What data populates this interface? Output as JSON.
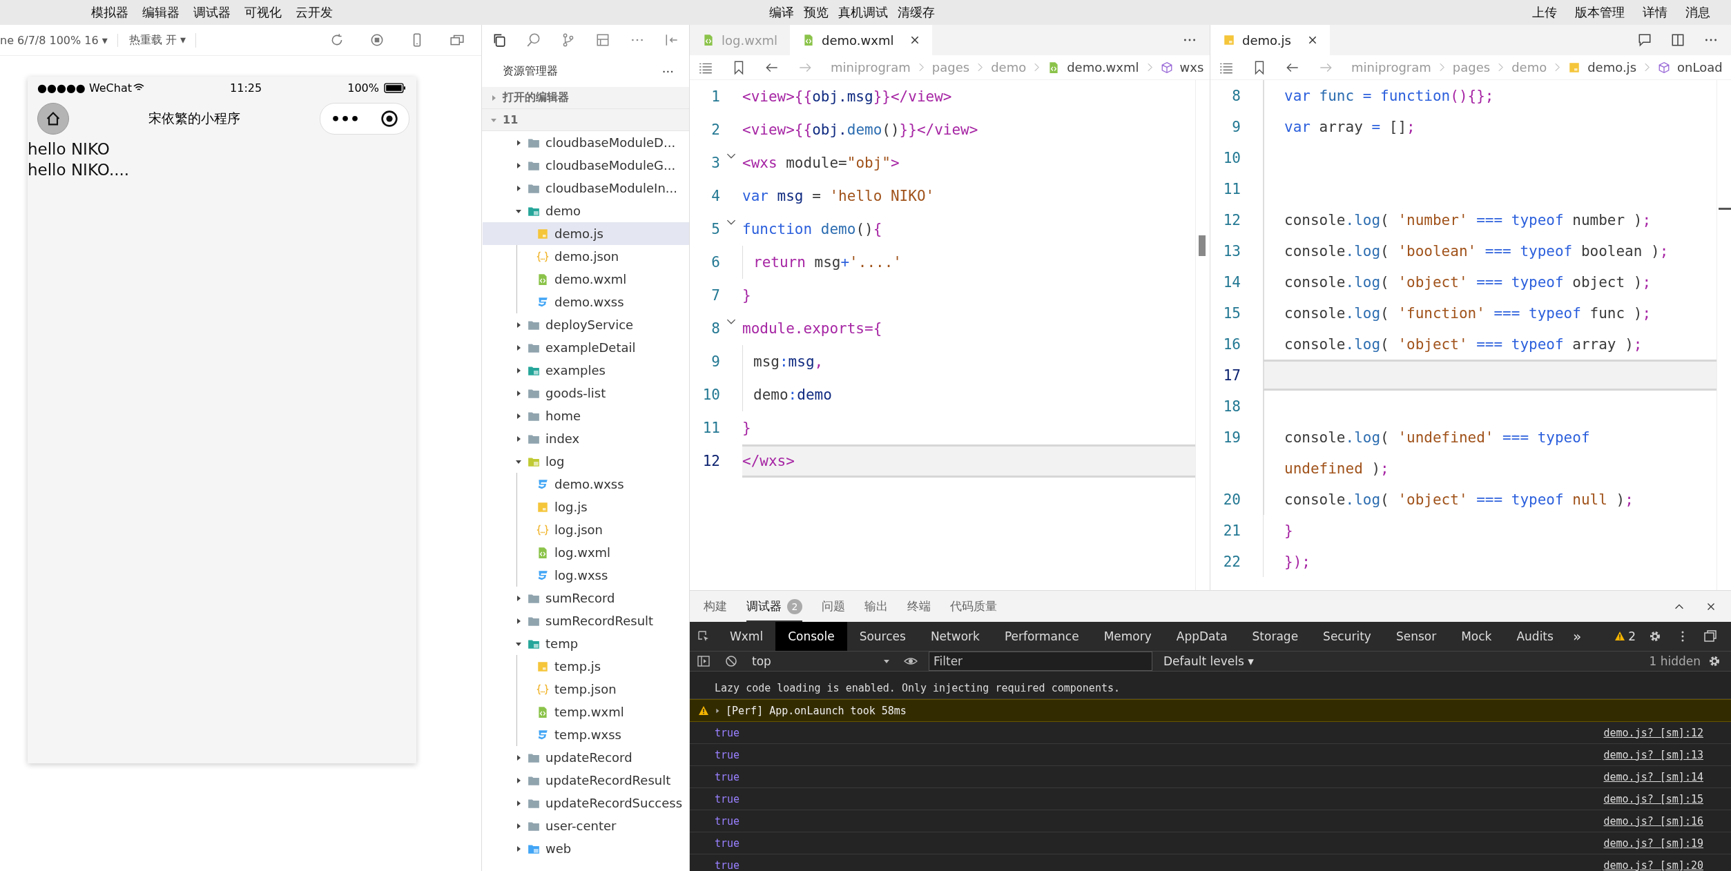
{
  "menu_bar": {
    "left": [
      "模拟器",
      "编辑器",
      "调试器",
      "可视化",
      "云开发"
    ],
    "center": [
      "编译",
      "预览",
      "真机调试",
      "清缓存"
    ],
    "right": [
      "上传",
      "版本管理",
      "详情",
      "消息"
    ]
  },
  "simulator": {
    "device_select": "ne 6/7/8 100% 16 ▾",
    "hot_reload": "热重载 开 ▾",
    "phone": {
      "carrier": "●●●●● WeChat",
      "time": "11:25",
      "battery": "100%",
      "title": "宋依繁的小程序",
      "capsule_more": "•••",
      "content": [
        "hello NIKO",
        "hello NIKO...."
      ]
    }
  },
  "explorer": {
    "title": "资源管理器",
    "more": "···",
    "sections": [
      {
        "label": "打开的编辑器",
        "expanded": false
      },
      {
        "label": "11",
        "expanded": true
      }
    ],
    "tree": [
      {
        "label": "cloudbaseModuleD...",
        "kind": "folder",
        "expanded": false,
        "selected": false
      },
      {
        "label": "cloudbaseModuleG...",
        "kind": "folder",
        "expanded": false,
        "selected": false
      },
      {
        "label": "cloudbaseModuleIn...",
        "kind": "folder",
        "expanded": false,
        "selected": false
      },
      {
        "label": "demo",
        "kind": "folder-image",
        "expanded": true,
        "selected": false,
        "children": [
          {
            "label": "demo.js",
            "kind": "js",
            "selected": true
          },
          {
            "label": "demo.json",
            "kind": "json",
            "selected": false
          },
          {
            "label": "demo.wxml",
            "kind": "wxml",
            "selected": false
          },
          {
            "label": "demo.wxss",
            "kind": "wxss",
            "selected": false
          }
        ]
      },
      {
        "label": "deployService",
        "kind": "folder",
        "expanded": false,
        "selected": false
      },
      {
        "label": "exampleDetail",
        "kind": "folder",
        "expanded": false,
        "selected": false
      },
      {
        "label": "examples",
        "kind": "folder-image",
        "expanded": false,
        "selected": false
      },
      {
        "label": "goods-list",
        "kind": "folder",
        "expanded": false,
        "selected": false
      },
      {
        "label": "home",
        "kind": "folder",
        "expanded": false,
        "selected": false
      },
      {
        "label": "index",
        "kind": "folder",
        "expanded": false,
        "selected": false
      },
      {
        "label": "log",
        "kind": "folder-log",
        "expanded": true,
        "selected": false,
        "children": [
          {
            "label": "demo.wxss",
            "kind": "wxss",
            "selected": false
          },
          {
            "label": "log.js",
            "kind": "js",
            "selected": false
          },
          {
            "label": "log.json",
            "kind": "json",
            "selected": false
          },
          {
            "label": "log.wxml",
            "kind": "wxml",
            "selected": false
          },
          {
            "label": "log.wxss",
            "kind": "wxss",
            "selected": false
          }
        ]
      },
      {
        "label": "sumRecord",
        "kind": "folder",
        "expanded": false,
        "selected": false
      },
      {
        "label": "sumRecordResult",
        "kind": "folder",
        "expanded": false,
        "selected": false
      },
      {
        "label": "temp",
        "kind": "folder-temp",
        "expanded": true,
        "selected": false,
        "children": [
          {
            "label": "temp.js",
            "kind": "js",
            "selected": false
          },
          {
            "label": "temp.json",
            "kind": "json",
            "selected": false
          },
          {
            "label": "temp.wxml",
            "kind": "wxml",
            "selected": false
          },
          {
            "label": "temp.wxss",
            "kind": "wxss",
            "selected": false
          }
        ]
      },
      {
        "label": "updateRecord",
        "kind": "folder",
        "expanded": false,
        "selected": false
      },
      {
        "label": "updateRecordResult",
        "kind": "folder",
        "expanded": false,
        "selected": false
      },
      {
        "label": "updateRecordSuccess",
        "kind": "folder",
        "expanded": false,
        "selected": false
      },
      {
        "label": "user-center",
        "kind": "folder",
        "expanded": false,
        "selected": false
      },
      {
        "label": "web",
        "kind": "folder-web",
        "expanded": false,
        "selected": false
      }
    ]
  },
  "editors": [
    {
      "tabs": [
        {
          "label": "log.wxml",
          "kind": "wxml",
          "selected": false
        },
        {
          "label": "demo.wxml",
          "kind": "wxml",
          "selected": true
        }
      ],
      "breadcrumb": [
        {
          "label": "miniprogram",
          "kind": "folder"
        },
        {
          "label": "pages",
          "kind": "folder"
        },
        {
          "label": "demo",
          "kind": "folder"
        },
        {
          "label": "demo.wxml",
          "kind": "wxml"
        },
        {
          "label": "wxs",
          "kind": "cube"
        }
      ],
      "lines": [
        {
          "number": "1",
          "current": false,
          "fold": false,
          "guide": false,
          "tokens": [
            {
              "kind": "tag",
              "text": "<view>"
            },
            {
              "kind": "punct",
              "text": "{{"
            },
            {
              "kind": "ident",
              "text": "obj.msg"
            },
            {
              "kind": "punct",
              "text": "}}"
            },
            {
              "kind": "tag",
              "text": "</view>"
            }
          ]
        },
        {
          "number": "2",
          "current": false,
          "fold": false,
          "guide": false,
          "tokens": [
            {
              "kind": "tag",
              "text": "<view>"
            },
            {
              "kind": "punct",
              "text": "{{"
            },
            {
              "kind": "ident",
              "text": "obj."
            },
            {
              "kind": "method",
              "text": "demo"
            },
            {
              "kind": "plain",
              "text": "()"
            },
            {
              "kind": "punct",
              "text": "}}"
            },
            {
              "kind": "tag",
              "text": "</view>"
            }
          ]
        },
        {
          "number": "3",
          "current": false,
          "fold": true,
          "guide": false,
          "tokens": [
            {
              "kind": "tag",
              "text": "<wxs"
            },
            {
              "kind": "plain",
              "text": " module="
            },
            {
              "kind": "string",
              "text": "\"obj\""
            },
            {
              "kind": "tag",
              "text": ">"
            }
          ]
        },
        {
          "number": "4",
          "current": false,
          "fold": false,
          "guide": false,
          "tokens": [
            {
              "kind": "keyword",
              "text": "var"
            },
            {
              "kind": "ident",
              "text": " msg"
            },
            {
              "kind": "plain",
              "text": " = "
            },
            {
              "kind": "string",
              "text": "'hello NIKO'"
            }
          ]
        },
        {
          "number": "5",
          "current": false,
          "fold": true,
          "guide": false,
          "tokens": [
            {
              "kind": "keyword",
              "text": "function"
            },
            {
              "kind": "method",
              "text": " demo"
            },
            {
              "kind": "plain",
              "text": "()"
            },
            {
              "kind": "punct",
              "text": "{"
            }
          ]
        },
        {
          "number": "6",
          "current": false,
          "fold": false,
          "guide": true,
          "tokens": [
            {
              "kind": "tag",
              "text": "return"
            },
            {
              "kind": "plain",
              "text": " msg"
            },
            {
              "kind": "keyword",
              "text": "+"
            },
            {
              "kind": "string",
              "text": "'....'"
            }
          ]
        },
        {
          "number": "7",
          "current": false,
          "fold": false,
          "guide": false,
          "tokens": [
            {
              "kind": "punct",
              "text": "}"
            }
          ]
        },
        {
          "number": "8",
          "current": false,
          "fold": true,
          "guide": false,
          "tokens": [
            {
              "kind": "tag",
              "text": "module.exports="
            },
            {
              "kind": "punct",
              "text": "{"
            }
          ]
        },
        {
          "number": "9",
          "current": false,
          "fold": false,
          "guide": true,
          "tokens": [
            {
              "kind": "plain",
              "text": "msg"
            },
            {
              "kind": "keyword",
              "text": ":"
            },
            {
              "kind": "ident",
              "text": "msg"
            },
            {
              "kind": "punct",
              "text": ","
            }
          ]
        },
        {
          "number": "10",
          "current": false,
          "fold": false,
          "guide": true,
          "tokens": [
            {
              "kind": "plain",
              "text": "demo"
            },
            {
              "kind": "keyword",
              "text": ":"
            },
            {
              "kind": "ident",
              "text": "demo"
            }
          ]
        },
        {
          "number": "11",
          "current": false,
          "fold": false,
          "guide": false,
          "tokens": [
            {
              "kind": "punct",
              "text": "}"
            }
          ]
        },
        {
          "number": "12",
          "current": true,
          "fold": false,
          "guide": false,
          "tokens": [
            {
              "kind": "tag",
              "text": "</wxs>"
            }
          ]
        }
      ]
    },
    {
      "tabs": [
        {
          "label": "demo.js",
          "kind": "js",
          "selected": true
        }
      ],
      "breadcrumb": [
        {
          "label": "miniprogram",
          "kind": "folder"
        },
        {
          "label": "pages",
          "kind": "folder"
        },
        {
          "label": "demo",
          "kind": "folder"
        },
        {
          "label": "demo.js",
          "kind": "js"
        },
        {
          "label": "onLoad",
          "kind": "cube"
        }
      ],
      "lines": [
        {
          "number": "8",
          "current": false,
          "fold": false,
          "guide": true,
          "tokens": [
            {
              "kind": "keyword",
              "text": "var"
            },
            {
              "kind": "method",
              "text": " func"
            },
            {
              "kind": "keyword",
              "text": " = function"
            },
            {
              "kind": "punct",
              "text": "(){}"
            },
            {
              "kind": "punct",
              "text": ";"
            }
          ]
        },
        {
          "number": "9",
          "current": false,
          "fold": false,
          "guide": true,
          "tokens": [
            {
              "kind": "keyword",
              "text": "var"
            },
            {
              "kind": "plain",
              "text": " array "
            },
            {
              "kind": "keyword",
              "text": "="
            },
            {
              "kind": "plain",
              "text": " []"
            },
            {
              "kind": "punct",
              "text": ";"
            }
          ]
        },
        {
          "number": "10",
          "current": false,
          "fold": false,
          "guide": true
        },
        {
          "number": "11",
          "current": false,
          "fold": false,
          "guide": true
        },
        {
          "number": "12",
          "current": false,
          "fold": false,
          "guide": true,
          "tokens": [
            {
              "kind": "plain",
              "text": "console"
            },
            {
              "kind": "method",
              "text": ".log"
            },
            {
              "kind": "plain",
              "text": "( "
            },
            {
              "kind": "string",
              "text": "'number'"
            },
            {
              "kind": "keyword",
              "text": " === typeof"
            },
            {
              "kind": "plain",
              "text": " number )"
            },
            {
              "kind": "punct",
              "text": ";"
            }
          ]
        },
        {
          "number": "13",
          "current": false,
          "fold": false,
          "guide": true,
          "tokens": [
            {
              "kind": "plain",
              "text": "console"
            },
            {
              "kind": "method",
              "text": ".log"
            },
            {
              "kind": "plain",
              "text": "( "
            },
            {
              "kind": "string",
              "text": "'boolean'"
            },
            {
              "kind": "keyword",
              "text": " === typeof"
            },
            {
              "kind": "plain",
              "text": " boolean )"
            },
            {
              "kind": "punct",
              "text": ";"
            }
          ]
        },
        {
          "number": "14",
          "current": false,
          "fold": false,
          "guide": true,
          "tokens": [
            {
              "kind": "plain",
              "text": "console"
            },
            {
              "kind": "method",
              "text": ".log"
            },
            {
              "kind": "plain",
              "text": "( "
            },
            {
              "kind": "string",
              "text": "'object'"
            },
            {
              "kind": "keyword",
              "text": " === typeof"
            },
            {
              "kind": "plain",
              "text": " object )"
            },
            {
              "kind": "punct",
              "text": ";"
            }
          ]
        },
        {
          "number": "15",
          "current": false,
          "fold": false,
          "guide": true,
          "tokens": [
            {
              "kind": "plain",
              "text": "console"
            },
            {
              "kind": "method",
              "text": ".log"
            },
            {
              "kind": "plain",
              "text": "( "
            },
            {
              "kind": "string",
              "text": "'function'"
            },
            {
              "kind": "keyword",
              "text": " === typeof"
            },
            {
              "kind": "plain",
              "text": " func )"
            },
            {
              "kind": "punct",
              "text": ";"
            }
          ]
        },
        {
          "number": "16",
          "current": false,
          "fold": false,
          "guide": true,
          "tokens": [
            {
              "kind": "plain",
              "text": "console"
            },
            {
              "kind": "method",
              "text": ".log"
            },
            {
              "kind": "plain",
              "text": "( "
            },
            {
              "kind": "string",
              "text": "'object'"
            },
            {
              "kind": "keyword",
              "text": " === typeof"
            },
            {
              "kind": "plain",
              "text": " array )"
            },
            {
              "kind": "punct",
              "text": ";"
            }
          ]
        },
        {
          "number": "17",
          "current": true,
          "fold": false,
          "guide": true
        },
        {
          "number": "18",
          "current": false,
          "fold": false,
          "guide": true
        },
        {
          "number": "19",
          "current": false,
          "fold": false,
          "guide": true,
          "tokens": [
            {
              "kind": "plain",
              "text": "console"
            },
            {
              "kind": "method",
              "text": ".log"
            },
            {
              "kind": "plain",
              "text": "( "
            },
            {
              "kind": "string",
              "text": "'undefined'"
            },
            {
              "kind": "keyword",
              "text": " === typeof"
            }
          ],
          "wrap_tokens": [
            {
              "kind": "string",
              "text": "undefined"
            },
            {
              "kind": "plain",
              "text": " )"
            },
            {
              "kind": "punct",
              "text": ";"
            }
          ]
        },
        {
          "number": "20",
          "current": false,
          "fold": false,
          "guide": true,
          "tokens": [
            {
              "kind": "plain",
              "text": "console"
            },
            {
              "kind": "method",
              "text": ".log"
            },
            {
              "kind": "plain",
              "text": "( "
            },
            {
              "kind": "string",
              "text": "'object'"
            },
            {
              "kind": "keyword",
              "text": " === typeof"
            },
            {
              "kind": "string",
              "text": " null"
            },
            {
              "kind": "plain",
              "text": " )"
            },
            {
              "kind": "punct",
              "text": ";"
            }
          ]
        },
        {
          "number": "21",
          "current": false,
          "fold": false,
          "guide": false,
          "tokens": [
            {
              "kind": "punct",
              "text": "}"
            }
          ]
        },
        {
          "number": "22",
          "current": false,
          "fold": false,
          "guide": false,
          "tokens": [
            {
              "kind": "punct",
              "text": "})"
            },
            {
              "kind": "punct",
              "text": ";"
            }
          ]
        }
      ]
    }
  ],
  "bottom_panel": {
    "tabs": [
      {
        "label": "构建",
        "selected": false
      },
      {
        "label": "调试器",
        "selected": true,
        "badge": "2"
      },
      {
        "label": "问题",
        "selected": false
      },
      {
        "label": "输出",
        "selected": false
      },
      {
        "label": "终端",
        "selected": false
      },
      {
        "label": "代码质量",
        "selected": false
      }
    ],
    "devtools_tabs": [
      {
        "label": "Wxml",
        "selected": false
      },
      {
        "label": "Console",
        "selected": true
      },
      {
        "label": "Sources",
        "selected": false
      },
      {
        "label": "Network",
        "selected": false
      },
      {
        "label": "Performance",
        "selected": false
      },
      {
        "label": "Memory",
        "selected": false
      },
      {
        "label": "AppData",
        "selected": false
      },
      {
        "label": "Storage",
        "selected": false
      },
      {
        "label": "Security",
        "selected": false
      },
      {
        "label": "Sensor",
        "selected": false
      },
      {
        "label": "Mock",
        "selected": false
      },
      {
        "label": "Audits",
        "selected": false
      }
    ],
    "more_tabs": "»",
    "warning_count": "2",
    "context": "top",
    "filter_placeholder": "Filter",
    "levels": "Default levels ▾",
    "hidden": "1 hidden",
    "messages": [
      {
        "kind": "info",
        "text": "Lazy code loading is enabled. Only injecting required components."
      },
      {
        "kind": "warning",
        "text": "[Perf] App.onLaunch took 58ms"
      },
      {
        "kind": "result",
        "text": "true",
        "source": "demo.js? [sm]:12"
      },
      {
        "kind": "result",
        "text": "true",
        "source": "demo.js? [sm]:13"
      },
      {
        "kind": "result",
        "text": "true",
        "source": "demo.js? [sm]:14"
      },
      {
        "kind": "result",
        "text": "true",
        "source": "demo.js? [sm]:15"
      },
      {
        "kind": "result",
        "text": "true",
        "source": "demo.js? [sm]:16"
      },
      {
        "kind": "result",
        "text": "true",
        "source": "demo.js? [sm]:19"
      },
      {
        "kind": "result",
        "text": "true",
        "source": "demo.js? [sm]:20"
      }
    ]
  }
}
